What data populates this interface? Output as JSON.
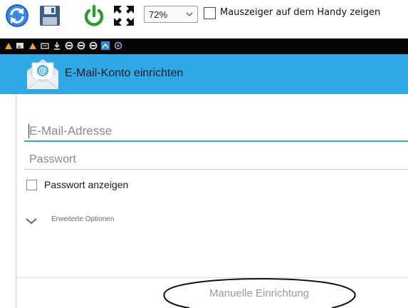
{
  "host_toolbar": {
    "icons": [
      "refresh-icon",
      "save-icon",
      "power-icon",
      "fullscreen-icon"
    ],
    "zoom": {
      "value": "72%"
    },
    "show_pointer": {
      "label": "Mauszeiger auf dem Handy zeigen",
      "checked": false
    }
  },
  "status_bar": {
    "icons": [
      "app-notification-icon",
      "image-notification-icon",
      "app-notification-icon",
      "keyboard-notification-icon",
      "download-icon",
      "sync-icon",
      "sync-icon",
      "sync-icon",
      "email-notification-icon",
      "settings-notification-icon"
    ]
  },
  "app_bar": {
    "icon": "email-app-icon",
    "title": "E-Mail-Konto einrichten",
    "color": "#2ea9e6"
  },
  "form": {
    "email": {
      "placeholder": "E-Mail-Adresse",
      "value": ""
    },
    "password": {
      "placeholder": "Passwort",
      "value": ""
    },
    "show_password": {
      "label": "Passwort anzeigen",
      "checked": false
    },
    "advanced": {
      "label": "Erweiterte Optionen",
      "icon": "chevron-down-icon"
    }
  },
  "footer": {
    "manual_setup_label": "Manuelle Einrichtung"
  }
}
